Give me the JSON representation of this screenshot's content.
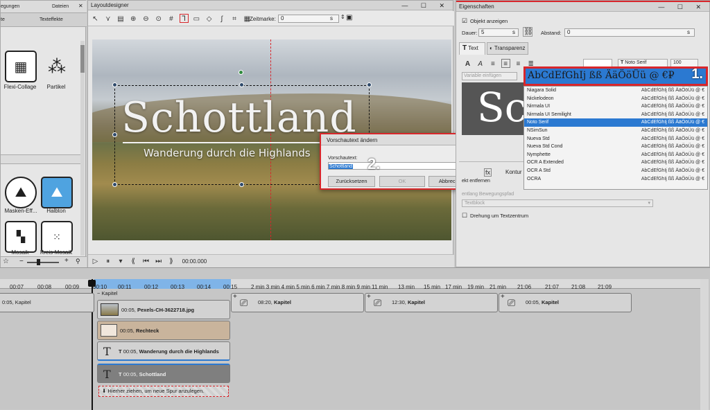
{
  "left_panel": {
    "tabs": [
      "egungen",
      "Dateien"
    ],
    "subtabs": [
      "te",
      "Texteffekte"
    ],
    "effects": [
      {
        "name": "Flexi-Collage",
        "icon": "flexi-collage-icon"
      },
      {
        "name": "Partikel",
        "icon": "particle-icon"
      },
      {
        "name": "Masken-Eff...",
        "icon": "mask-effect-icon"
      },
      {
        "name": "Halbton",
        "icon": "halftone-icon"
      },
      {
        "name": "Mosaik",
        "icon": "mosaic-icon"
      },
      {
        "name": "Kreis-Mosaik",
        "icon": "circle-mosaic-icon"
      }
    ]
  },
  "layout": {
    "title": "Layoutdesigner",
    "zeitmarke_label": "Zeitmarke:",
    "zeitmarke_value": "0",
    "zeitmarke_unit": "s",
    "slide_title": "Schottland",
    "slide_subtitle": "Wanderung durch die Highlands",
    "time": "00:00.000"
  },
  "dialog": {
    "title": "Vorschautext ändern",
    "field_label": "Vorschautext:",
    "field_value": "Schottland",
    "reset_label": "Zurücksetzen",
    "ok_label": "OK",
    "cancel_label": "Abbrechen",
    "step_label": "2."
  },
  "properties": {
    "title": "Eigenschaften",
    "show_object_label": "Objekt anzeigen",
    "duration_label": "Dauer:",
    "duration_value": "5",
    "duration_unit": "s",
    "distance_label": "Abstand:",
    "distance_value": "0",
    "distance_unit": "s",
    "tab_text": "Text",
    "tab_transparency": "Transparenz",
    "variable_placeholder": "Variable einfügen",
    "font_name": "Noto Serif",
    "font_size": "100",
    "preview_glyph": "Sc",
    "contour_label": "Kontur",
    "remove_effect_label": "ekt entfernen",
    "follow_path_label": "entlang Bewegungspfad",
    "textblock_label": "Textblock",
    "rotate_label": "Drehung um Textzentrum",
    "step_label": "1."
  },
  "font_dropdown": {
    "preview_text": "AbCdEfGhIj ßß ÄäÖöÜü @ €₽",
    "fonts": [
      {
        "name": "Niagara Solid",
        "sample": "AbCdEfGhIj ßß ÄäÖöÜü @ €"
      },
      {
        "name": "Nickelodeon",
        "sample": "AbCdEfGhIj ßß ÄäÖöÜü @ €"
      },
      {
        "name": "Nirmala UI",
        "sample": "AbCdEfGhIj ßß ÄäÖöÜü @ €"
      },
      {
        "name": "Nirmala UI Semilight",
        "sample": "AbCdEfGhIj ßß ÄäÖöÜü @ €"
      },
      {
        "name": "Noto Serif",
        "sample": "AbCdEfGhIj ßß ÄäÖöÜü @ €"
      },
      {
        "name": "NSimSun",
        "sample": "AbCdEfGhIj ßß ÄäÖöÜü @ €"
      },
      {
        "name": "Nueva Std",
        "sample": "AbCdEfGhIj ßß ÄäÖöÜü @ €"
      },
      {
        "name": "Nueva Std Cond",
        "sample": "AbCdEfGhIj ßß ÄäÖöÜü @ €"
      },
      {
        "name": "Nymphette",
        "sample": "AbCdEfGhIj ßß ÄäÖöÜü @ €"
      },
      {
        "name": "OCR A Extended",
        "sample": "AbCdEfGhIj ßß ÄäÖöÜü @ €"
      },
      {
        "name": "OCR A Std",
        "sample": "AbCdEfGhIj ßß ÄäÖöÜü @ €"
      },
      {
        "name": "OCRA",
        "sample": "AbCdEfGhIj ßß ÄäÖöÜü @ €"
      }
    ]
  },
  "timeline": {
    "ruler": [
      "00:07",
      "00:08",
      "00:09",
      "00:10",
      "00:11",
      "00:12",
      "00:13",
      "00:14",
      "00:15",
      "2 min 3 min 4 min 5 min 6 min 7 min 8 min 9 min",
      "11 min",
      "13 min",
      "15 min",
      "17 min",
      "19 min",
      "21 min",
      "21:06",
      "21:07",
      "21:08",
      "21:09"
    ],
    "left_clip": "0:05, Kapitel",
    "chapter_label": "Kapitel",
    "chapters": [
      {
        "time": "08:20,",
        "name": "Kapitel"
      },
      {
        "time": "12:30,",
        "name": "Kapitel"
      },
      {
        "time": "00:05,",
        "name": "Kapitel"
      }
    ],
    "tracks": [
      {
        "time": "00:05,",
        "name": "Pexels-CH-3622718.jpg"
      },
      {
        "time": "00:05,",
        "name": "Rechteck"
      },
      {
        "time": "00:05,",
        "name": "Wanderung durch die Highlands"
      },
      {
        "time": "00:05,",
        "name": "Schottland"
      }
    ],
    "drop_hint": "Hierher ziehen, um neue Spur anzulegen."
  },
  "colors": {
    "accent": "#1e70c8",
    "highlight": "#d8262b",
    "selection": "#2b79d1"
  }
}
